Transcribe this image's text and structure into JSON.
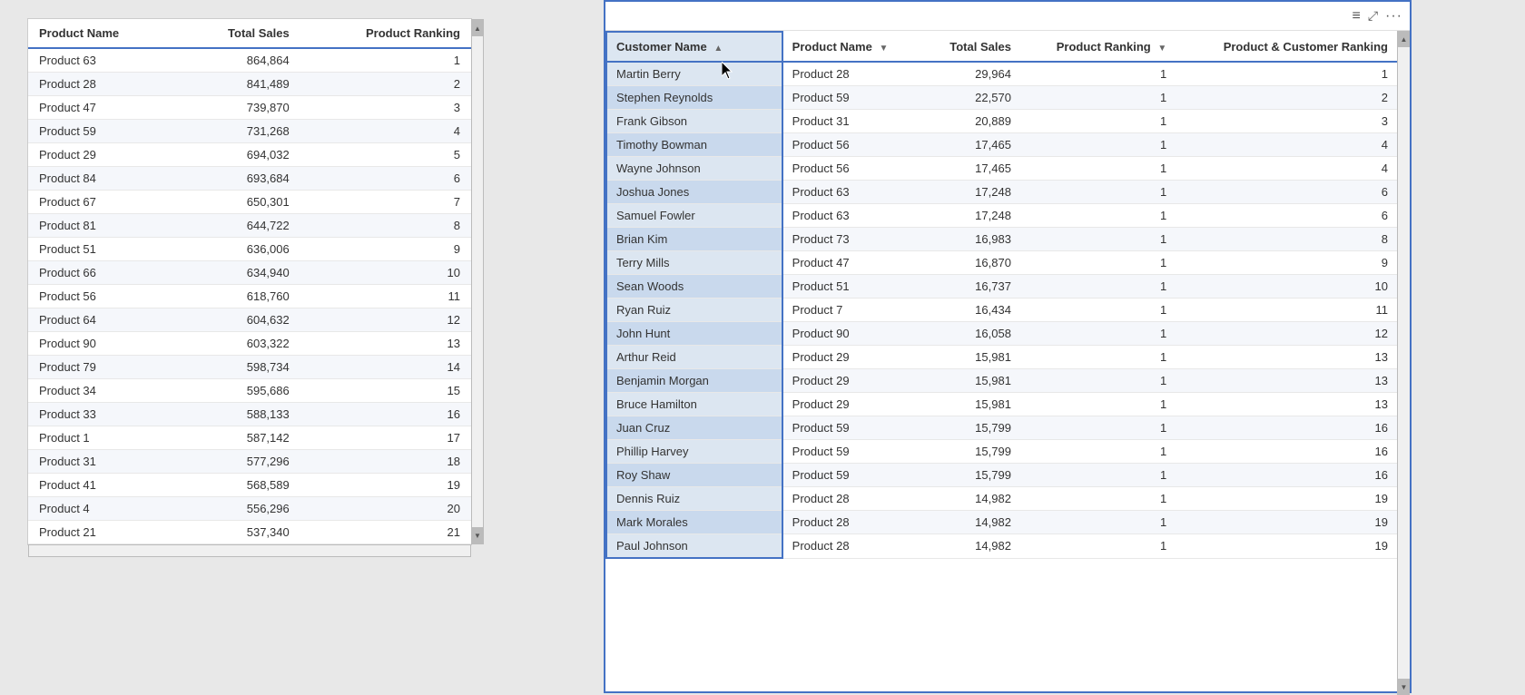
{
  "leftTable": {
    "columns": [
      {
        "label": "Product Name",
        "key": "productName",
        "numeric": false
      },
      {
        "label": "Total Sales",
        "key": "totalSales",
        "numeric": true
      },
      {
        "label": "Product Ranking",
        "key": "productRanking",
        "numeric": true
      }
    ],
    "rows": [
      {
        "productName": "Product 63",
        "totalSales": "864,864",
        "productRanking": "1"
      },
      {
        "productName": "Product 28",
        "totalSales": "841,489",
        "productRanking": "2"
      },
      {
        "productName": "Product 47",
        "totalSales": "739,870",
        "productRanking": "3"
      },
      {
        "productName": "Product 59",
        "totalSales": "731,268",
        "productRanking": "4"
      },
      {
        "productName": "Product 29",
        "totalSales": "694,032",
        "productRanking": "5"
      },
      {
        "productName": "Product 84",
        "totalSales": "693,684",
        "productRanking": "6"
      },
      {
        "productName": "Product 67",
        "totalSales": "650,301",
        "productRanking": "7"
      },
      {
        "productName": "Product 81",
        "totalSales": "644,722",
        "productRanking": "8"
      },
      {
        "productName": "Product 51",
        "totalSales": "636,006",
        "productRanking": "9"
      },
      {
        "productName": "Product 66",
        "totalSales": "634,940",
        "productRanking": "10"
      },
      {
        "productName": "Product 56",
        "totalSales": "618,760",
        "productRanking": "11"
      },
      {
        "productName": "Product 64",
        "totalSales": "604,632",
        "productRanking": "12"
      },
      {
        "productName": "Product 90",
        "totalSales": "603,322",
        "productRanking": "13"
      },
      {
        "productName": "Product 79",
        "totalSales": "598,734",
        "productRanking": "14"
      },
      {
        "productName": "Product 34",
        "totalSales": "595,686",
        "productRanking": "15"
      },
      {
        "productName": "Product 33",
        "totalSales": "588,133",
        "productRanking": "16"
      },
      {
        "productName": "Product 1",
        "totalSales": "587,142",
        "productRanking": "17"
      },
      {
        "productName": "Product 31",
        "totalSales": "577,296",
        "productRanking": "18"
      },
      {
        "productName": "Product 41",
        "totalSales": "568,589",
        "productRanking": "19"
      },
      {
        "productName": "Product 4",
        "totalSales": "556,296",
        "productRanking": "20"
      },
      {
        "productName": "Product 21",
        "totalSales": "537,340",
        "productRanking": "21"
      }
    ]
  },
  "rightTable": {
    "columns": [
      {
        "label": "Customer Name",
        "key": "customerName",
        "numeric": false,
        "isHighlighted": true,
        "sortArrow": "▲"
      },
      {
        "label": "Product Name",
        "key": "productName",
        "numeric": false,
        "sortArrow": "▼"
      },
      {
        "label": "Total Sales",
        "key": "totalSales",
        "numeric": true
      },
      {
        "label": "Product Ranking",
        "key": "productRanking",
        "numeric": true,
        "sortArrow": "▼"
      },
      {
        "label": "Product & Customer Ranking",
        "key": "pcRanking",
        "numeric": true
      }
    ],
    "rows": [
      {
        "customerName": "Martin Berry",
        "productName": "Product 28",
        "totalSales": "29,964",
        "productRanking": "1",
        "pcRanking": "1"
      },
      {
        "customerName": "Stephen Reynolds",
        "productName": "Product 59",
        "totalSales": "22,570",
        "productRanking": "1",
        "pcRanking": "2"
      },
      {
        "customerName": "Frank Gibson",
        "productName": "Product 31",
        "totalSales": "20,889",
        "productRanking": "1",
        "pcRanking": "3"
      },
      {
        "customerName": "Timothy Bowman",
        "productName": "Product 56",
        "totalSales": "17,465",
        "productRanking": "1",
        "pcRanking": "4"
      },
      {
        "customerName": "Wayne Johnson",
        "productName": "Product 56",
        "totalSales": "17,465",
        "productRanking": "1",
        "pcRanking": "4"
      },
      {
        "customerName": "Joshua Jones",
        "productName": "Product 63",
        "totalSales": "17,248",
        "productRanking": "1",
        "pcRanking": "6"
      },
      {
        "customerName": "Samuel Fowler",
        "productName": "Product 63",
        "totalSales": "17,248",
        "productRanking": "1",
        "pcRanking": "6"
      },
      {
        "customerName": "Brian Kim",
        "productName": "Product 73",
        "totalSales": "16,983",
        "productRanking": "1",
        "pcRanking": "8"
      },
      {
        "customerName": "Terry Mills",
        "productName": "Product 47",
        "totalSales": "16,870",
        "productRanking": "1",
        "pcRanking": "9"
      },
      {
        "customerName": "Sean Woods",
        "productName": "Product 51",
        "totalSales": "16,737",
        "productRanking": "1",
        "pcRanking": "10"
      },
      {
        "customerName": "Ryan Ruiz",
        "productName": "Product 7",
        "totalSales": "16,434",
        "productRanking": "1",
        "pcRanking": "11"
      },
      {
        "customerName": "John Hunt",
        "productName": "Product 90",
        "totalSales": "16,058",
        "productRanking": "1",
        "pcRanking": "12"
      },
      {
        "customerName": "Arthur Reid",
        "productName": "Product 29",
        "totalSales": "15,981",
        "productRanking": "1",
        "pcRanking": "13"
      },
      {
        "customerName": "Benjamin Morgan",
        "productName": "Product 29",
        "totalSales": "15,981",
        "productRanking": "1",
        "pcRanking": "13"
      },
      {
        "customerName": "Bruce Hamilton",
        "productName": "Product 29",
        "totalSales": "15,981",
        "productRanking": "1",
        "pcRanking": "13"
      },
      {
        "customerName": "Juan Cruz",
        "productName": "Product 59",
        "totalSales": "15,799",
        "productRanking": "1",
        "pcRanking": "16"
      },
      {
        "customerName": "Phillip Harvey",
        "productName": "Product 59",
        "totalSales": "15,799",
        "productRanking": "1",
        "pcRanking": "16"
      },
      {
        "customerName": "Roy Shaw",
        "productName": "Product 59",
        "totalSales": "15,799",
        "productRanking": "1",
        "pcRanking": "16"
      },
      {
        "customerName": "Dennis Ruiz",
        "productName": "Product 28",
        "totalSales": "14,982",
        "productRanking": "1",
        "pcRanking": "19"
      },
      {
        "customerName": "Mark Morales",
        "productName": "Product 28",
        "totalSales": "14,982",
        "productRanking": "1",
        "pcRanking": "19"
      },
      {
        "customerName": "Paul Johnson",
        "productName": "Product 28",
        "totalSales": "14,982",
        "productRanking": "1",
        "pcRanking": "19"
      }
    ]
  },
  "icons": {
    "menu": "≡",
    "expand": "⛶",
    "more": "···",
    "scrollUp": "▲",
    "scrollDown": "▼",
    "sortAsc": "▲",
    "sortDesc": "▼"
  }
}
